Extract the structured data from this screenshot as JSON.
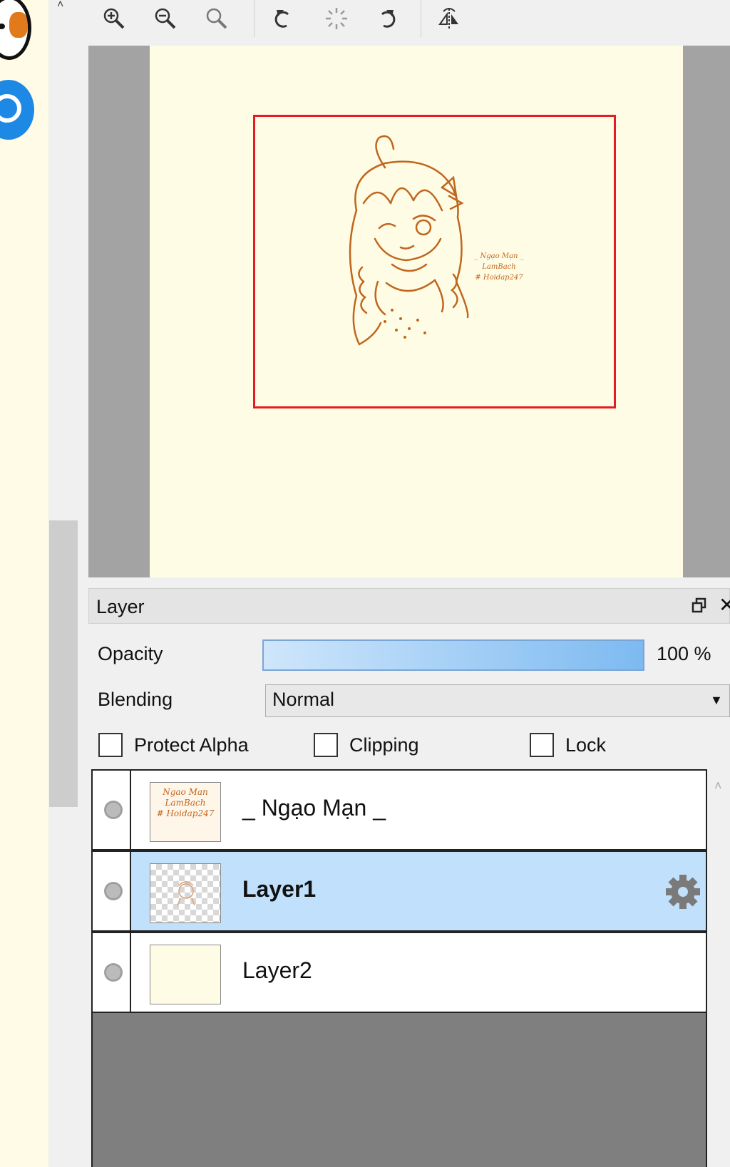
{
  "colors": {
    "paper": "#fffce6",
    "workspace": "#a3a3a3",
    "selection": "#e51c23",
    "sketch_line": "#c0661e",
    "selected_row": "#c1e0fb",
    "opacity_fill": "#7dbaf1"
  },
  "toolbar": {
    "buttons": [
      {
        "icon": "zoom-in-icon"
      },
      {
        "icon": "zoom-out-icon"
      },
      {
        "icon": "zoom-reset-icon"
      },
      {
        "icon": "rotate-left-icon"
      },
      {
        "icon": "rotate-reset-icon"
      },
      {
        "icon": "rotate-right-icon"
      },
      {
        "icon": "flip-horizontal-icon"
      }
    ]
  },
  "canvas": {
    "watermark_lines": [
      "_ Ngạo Mạn _",
      "LamBach",
      "# Hoidap247"
    ]
  },
  "layer_panel": {
    "title": "Layer",
    "opacity_label": "Opacity",
    "opacity_value_text": "100 %",
    "opacity_fraction": 1.0,
    "blending_label": "Blending",
    "blending_value": "Normal",
    "checkboxes": {
      "protect_alpha": {
        "label": "Protect Alpha",
        "checked": false
      },
      "clipping": {
        "label": "Clipping",
        "checked": false
      },
      "lock": {
        "label": "Lock",
        "checked": false
      }
    },
    "layers": [
      {
        "name": "_ Ngạo Mạn _",
        "selected": false,
        "thumb_lines": [
          "Ngao Man",
          "LamBach",
          "# Hoidap247"
        ]
      },
      {
        "name": "Layer1",
        "selected": true
      },
      {
        "name": "Layer2",
        "selected": false
      }
    ]
  }
}
